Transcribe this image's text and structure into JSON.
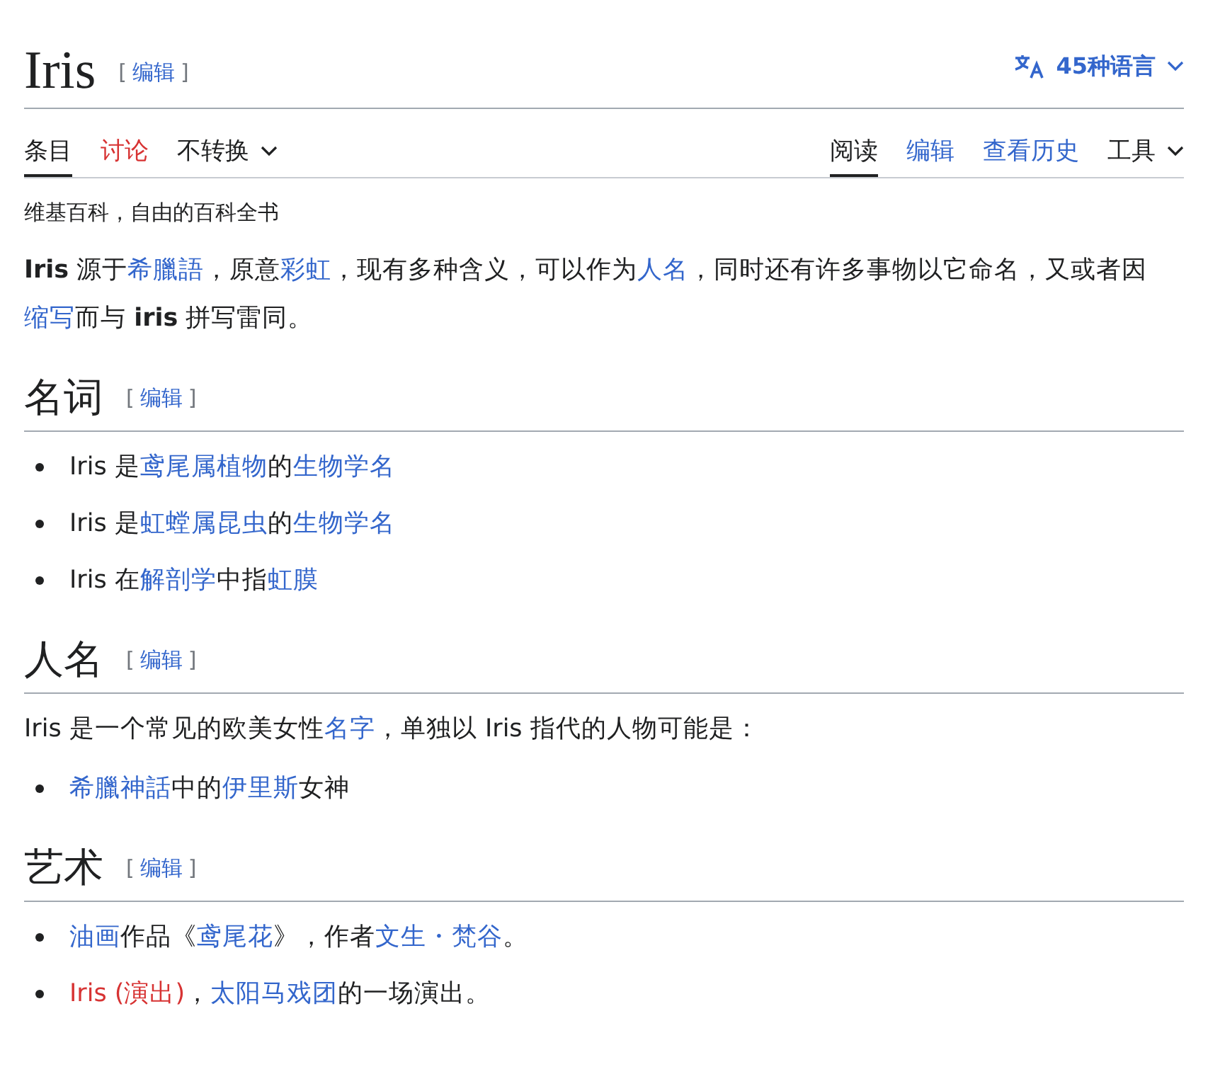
{
  "page": {
    "title": "Iris",
    "edit": {
      "open": "[",
      "label": "编辑",
      "close": "]"
    },
    "languages": "45种语言"
  },
  "tabs_left": [
    {
      "label": "条目",
      "selected": true,
      "kind": "tab"
    },
    {
      "label": "讨论",
      "selected": false,
      "kind": "redtab"
    },
    {
      "label": "不转换",
      "selected": false,
      "kind": "dropdown"
    }
  ],
  "tabs_right": [
    {
      "label": "阅读",
      "selected": true,
      "kind": "tab"
    },
    {
      "label": "编辑",
      "selected": false,
      "kind": "link"
    },
    {
      "label": "查看历史",
      "selected": false,
      "kind": "link"
    },
    {
      "label": "工具",
      "selected": false,
      "kind": "dropdown"
    }
  ],
  "tagline": "维基百科，自由的百科全书",
  "intro": [
    {
      "kind": "bold",
      "text": "Iris"
    },
    {
      "kind": "text",
      "text": " 源于"
    },
    {
      "kind": "link",
      "text": "希臘語"
    },
    {
      "kind": "text",
      "text": "，原意"
    },
    {
      "kind": "link",
      "text": "彩虹"
    },
    {
      "kind": "text",
      "text": "，现有多种含义，可以作为"
    },
    {
      "kind": "link",
      "text": "人名"
    },
    {
      "kind": "text",
      "text": "，同时还有许多事物以它命名，又或者因"
    },
    {
      "kind": "link",
      "text": "缩写"
    },
    {
      "kind": "text",
      "text": "而与 "
    },
    {
      "kind": "bold",
      "text": "iris"
    },
    {
      "kind": "text",
      "text": " 拼写雷同。"
    }
  ],
  "sections": [
    {
      "heading": "名词",
      "edit": {
        "open": "[",
        "label": "编辑",
        "close": "]"
      },
      "items": [
        [
          {
            "kind": "text",
            "text": "Iris 是"
          },
          {
            "kind": "link",
            "text": "鸢尾属植物"
          },
          {
            "kind": "text",
            "text": "的"
          },
          {
            "kind": "link",
            "text": "生物学名"
          }
        ],
        [
          {
            "kind": "text",
            "text": "Iris 是"
          },
          {
            "kind": "link",
            "text": "虹螳属昆虫"
          },
          {
            "kind": "text",
            "text": "的"
          },
          {
            "kind": "link",
            "text": "生物学名"
          }
        ],
        [
          {
            "kind": "text",
            "text": "Iris 在"
          },
          {
            "kind": "link",
            "text": "解剖学"
          },
          {
            "kind": "text",
            "text": "中指"
          },
          {
            "kind": "link",
            "text": "虹膜"
          }
        ]
      ]
    },
    {
      "heading": "人名",
      "edit": {
        "open": "[",
        "label": "编辑",
        "close": "]"
      },
      "paragraph": [
        {
          "kind": "text",
          "text": "Iris 是一个常见的欧美女性"
        },
        {
          "kind": "link",
          "text": "名字"
        },
        {
          "kind": "text",
          "text": "，单独以 Iris 指代的人物可能是："
        }
      ],
      "items": [
        [
          {
            "kind": "link",
            "text": "希臘神話"
          },
          {
            "kind": "text",
            "text": "中的"
          },
          {
            "kind": "link",
            "text": "伊里斯"
          },
          {
            "kind": "text",
            "text": "女神"
          }
        ]
      ]
    },
    {
      "heading": "艺术",
      "edit": {
        "open": "[",
        "label": "编辑",
        "close": "]"
      },
      "items": [
        [
          {
            "kind": "link",
            "text": "油画"
          },
          {
            "kind": "text",
            "text": "作品《"
          },
          {
            "kind": "link",
            "text": "鸢尾花"
          },
          {
            "kind": "text",
            "text": "》，作者"
          },
          {
            "kind": "link",
            "text": "文生・梵谷"
          },
          {
            "kind": "text",
            "text": "。"
          }
        ],
        [
          {
            "kind": "redlink",
            "text": "Iris (演出)"
          },
          {
            "kind": "text",
            "text": "，"
          },
          {
            "kind": "link",
            "text": "太阳马戏团"
          },
          {
            "kind": "text",
            "text": "的一场演出。"
          }
        ]
      ]
    }
  ]
}
